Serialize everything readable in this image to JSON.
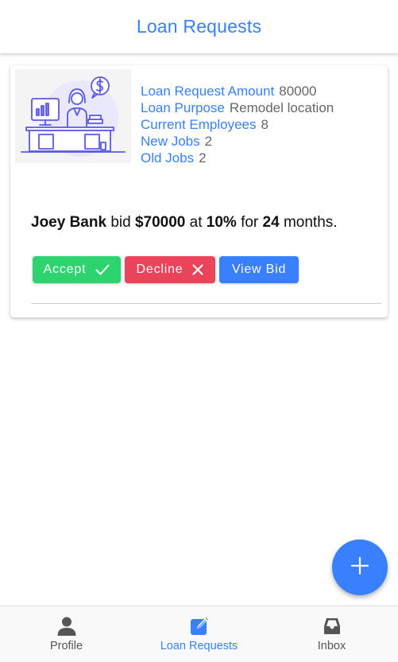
{
  "header": {
    "title": "Loan Requests"
  },
  "loan_card": {
    "illustration": "person-at-desk-with-dollar-bubble",
    "details": [
      {
        "label": "Loan Request Amount",
        "value": "80000"
      },
      {
        "label": "Loan Purpose",
        "value": "Remodel location"
      },
      {
        "label": "Current Employees",
        "value": "8"
      },
      {
        "label": "New Jobs",
        "value": "2"
      },
      {
        "label": "Old Jobs",
        "value": "2"
      }
    ],
    "bid": {
      "bank": "Joey Bank",
      "text_bid": " bid ",
      "amount": "$70000",
      "text_at": " at ",
      "rate": "10%",
      "text_for": " for ",
      "months": "24",
      "text_suffix": " months."
    },
    "actions": {
      "accept_label": "Accept",
      "accept_icon": "checkmark-icon",
      "decline_label": "Decline",
      "decline_icon": "close-icon",
      "view_label": "View Bid"
    }
  },
  "fab": {
    "icon": "add-icon"
  },
  "tabs": [
    {
      "label": "Profile",
      "icon": "person-icon",
      "selected": false
    },
    {
      "label": "Loan Requests",
      "icon": "create-icon",
      "selected": true
    },
    {
      "label": "Inbox",
      "icon": "file-tray-icon",
      "selected": false
    }
  ],
  "colors": {
    "primary": "#3880ff",
    "success": "#2dd36f",
    "danger": "#eb445a",
    "text": "#111111",
    "muted": "#666666",
    "tab_inactive": "#555555"
  }
}
